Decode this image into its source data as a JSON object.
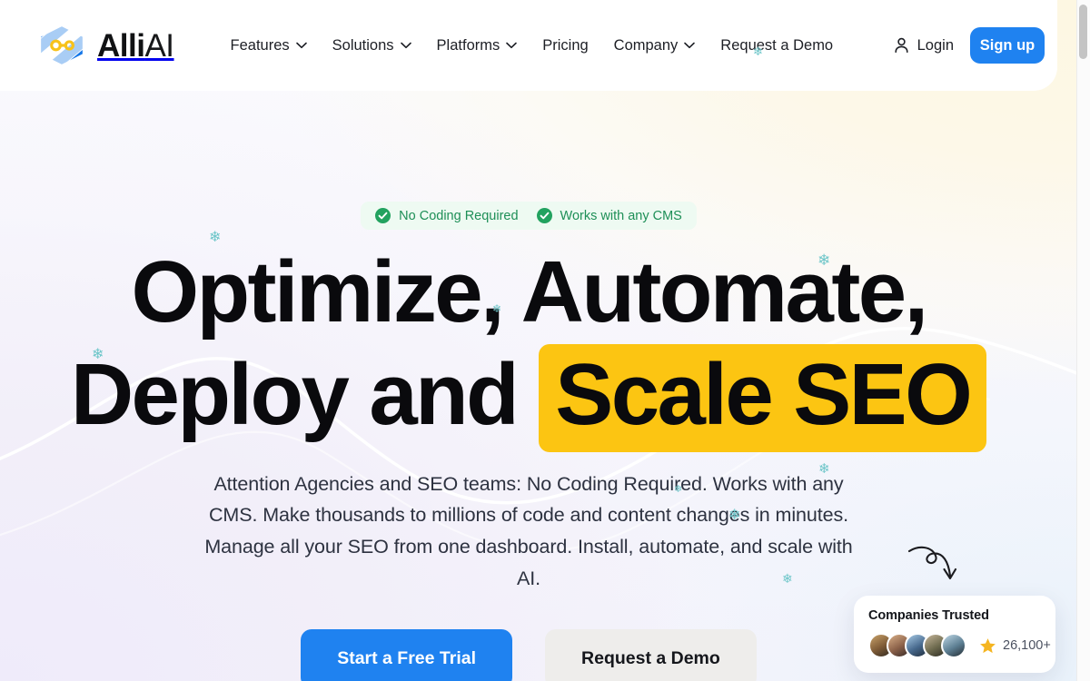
{
  "brand": {
    "name_bold": "Alli",
    "name_light": "AI",
    "logo_icon": "alli-hexagon-link-logo"
  },
  "nav": {
    "items": [
      {
        "label": "Features",
        "has_dropdown": true,
        "icon": "chevron-down-icon"
      },
      {
        "label": "Solutions",
        "has_dropdown": true,
        "icon": "chevron-down-icon"
      },
      {
        "label": "Platforms",
        "has_dropdown": true,
        "icon": "chevron-down-icon"
      },
      {
        "label": "Pricing",
        "has_dropdown": false,
        "icon": ""
      },
      {
        "label": "Company",
        "has_dropdown": true,
        "icon": "chevron-down-icon"
      },
      {
        "label": "Request a Demo",
        "has_dropdown": false,
        "icon": ""
      }
    ],
    "login_label": "Login",
    "login_icon": "user-icon",
    "signup_label": "Sign up",
    "signup_color": "#1f82f0"
  },
  "hero": {
    "badges": [
      {
        "label": "No Coding Required",
        "icon": "check-circle-icon"
      },
      {
        "label": "Works with any CMS",
        "icon": "check-circle-icon"
      }
    ],
    "badge_bg": "#eefaf2",
    "badge_text_color": "#1e8f57",
    "headline_line1": "Optimize, Automate,",
    "headline_line2_prefix": "Deploy and ",
    "headline_highlight": "Scale SEO",
    "highlight_color": "#fcc512",
    "subtitle": "Attention Agencies and SEO teams: No Coding Required. Works with any CMS. Make thousands to millions of code and content changes in minutes. Manage all your SEO from one dashboard. Install, automate, and scale with AI.",
    "cta_primary": "Start a Free Trial",
    "cta_secondary": "Request a Demo"
  },
  "trust_card": {
    "title": "Companies Trusted",
    "count": "26,100+",
    "star_icon": "star-icon",
    "avatar_count": 5
  },
  "decor": {
    "arrow_icon": "curly-arrow-icon",
    "snowflake_icon": "snowflake-icon",
    "snowflake_color": "#6dc6c9"
  },
  "scrollbar": {
    "position": "right",
    "thumb_at": "top"
  }
}
